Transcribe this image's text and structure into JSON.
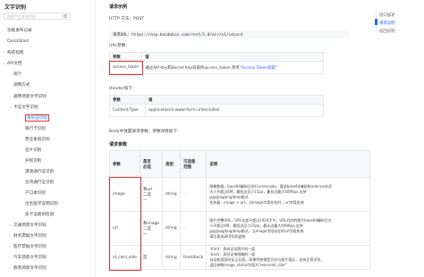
{
  "sidebar": {
    "title": "文字识别",
    "search_placeholder": "搜索产品文档内容",
    "items": [
      {
        "label": "功能发布记录",
        "chev": "",
        "indent": 0
      },
      {
        "label": "QuickStart",
        "chev": "",
        "indent": 0
      },
      {
        "label": "购买指南",
        "chev": "›",
        "indent": 0
      },
      {
        "label": "API文档",
        "chev": "⌄",
        "indent": 0
      },
      {
        "label": "简介",
        "chev": "",
        "indent": 1
      },
      {
        "label": "调用方式",
        "chev": "",
        "indent": 1
      },
      {
        "label": "通用场景文字识别",
        "chev": "›",
        "indent": 1
      },
      {
        "label": "卡证文字识别",
        "chev": "⌄",
        "indent": 1
      },
      {
        "label": "身份证识别",
        "chev": "",
        "indent": 2,
        "active": true
      },
      {
        "label": "银行卡识别",
        "chev": "",
        "indent": 2
      },
      {
        "label": "营业执照识别",
        "chev": "",
        "indent": 2
      },
      {
        "label": "名片识别",
        "chev": "",
        "indent": 2
      },
      {
        "label": "护照识别",
        "chev": "",
        "indent": 2
      },
      {
        "label": "港澳通行证识别",
        "chev": "",
        "indent": 2
      },
      {
        "label": "台湾通行证识别",
        "chev": "",
        "indent": 2
      },
      {
        "label": "户口本识别",
        "chev": "",
        "indent": 2
      },
      {
        "label": "出生医学证明识别",
        "chev": "",
        "indent": 2
      },
      {
        "label": "多卡证类别检测",
        "chev": "",
        "indent": 2
      },
      {
        "label": "交通场景文字识别",
        "chev": "›",
        "indent": 1
      },
      {
        "label": "财务票据文字识别",
        "chev": "›",
        "indent": 1
      },
      {
        "label": "医疗票据文字识别",
        "chev": "›",
        "indent": 1
      },
      {
        "label": "汽车场景文字识别",
        "chev": "›",
        "indent": 1
      },
      {
        "label": "教育场景文字识别",
        "chev": "›",
        "indent": 1
      }
    ]
  },
  "main": {
    "request_example_heading": "请求示例",
    "http_method": "HTTP 方法：POST",
    "request_url_label": "请求URL：",
    "request_url": "https://aip.baidubce.com/rest/2.0/ocr/v1/idcard",
    "url_params_label": "URL参数：",
    "url_table": {
      "headers": [
        "参数",
        "值"
      ],
      "rows": [
        {
          "param": "access_token",
          "value_prefix": "通过API Key和Secret Key获取的access_token,参考“",
          "value_link": "Access Token获取",
          "value_suffix": "”"
        }
      ]
    },
    "header_label": "Header如下：",
    "header_table": {
      "headers": [
        "参数",
        "值"
      ],
      "rows": [
        {
          "param": "Content-Type",
          "value": "application/x-www-form-urlencoded"
        }
      ]
    },
    "body_label": "Body中放置请求参数，参数详情如下：",
    "request_params_heading": "请求参数",
    "param_table": {
      "headers": [
        "参数",
        "是否必选",
        "类型",
        "可选值范围",
        "说明"
      ],
      "header_lines": [
        [
          "参数"
        ],
        [
          "是否",
          "必选"
        ],
        [
          "类型"
        ],
        [
          "可选值",
          "范围"
        ],
        [
          "说明"
        ]
      ],
      "rows": [
        {
          "param": "image",
          "required": [
            "和url",
            "二选",
            "一"
          ],
          "type": "string",
          "range": "-",
          "desc": [
            "图像数据，base64编码后进行urlencode，要求base64编码和urlencode后",
            "大小不超过4M，最短边至少15px，最长边最大4096px,支持",
            "jpg/jpeg/png/bmp格式",
            "优先级：image > url，当image字段存在时，url字段失效"
          ]
        },
        {
          "param": "url",
          "required": [
            "和image",
            "二选",
            "一"
          ],
          "type": "string",
          "range": "-",
          "desc": [
            "图片完整URL，URL长度不超过1024字节，URL对应的图片base64编码后大",
            "小不超过4M，最短边至少15px，最长边最大4096px,支持",
            "jpg/jpeg/png/bmp格式，当image字段存在时url字段失效",
            "请注意关闭URL防盗链"
          ]
        },
        {
          "param": "id_card_side",
          "required": [
            "是"
          ],
          "type": "string",
          "range": "front/back",
          "desc": [
            "-front：身份证含照片的一面",
            "-back：身份证带国徽的一面",
            "自动检测身份证正反面，如果传参指定方向与图片相反，支持正常识别，",
            "返回参数image_status字段为\"reversed_side\""
          ]
        }
      ]
    }
  },
  "toc": {
    "items": [
      {
        "label": "接口描述",
        "active": false
      },
      {
        "label": "请求说明",
        "active": true
      },
      {
        "label": "返回说明",
        "active": false
      }
    ]
  },
  "colors": {
    "link": "#2468f2",
    "highlight_box": "#e43030"
  }
}
